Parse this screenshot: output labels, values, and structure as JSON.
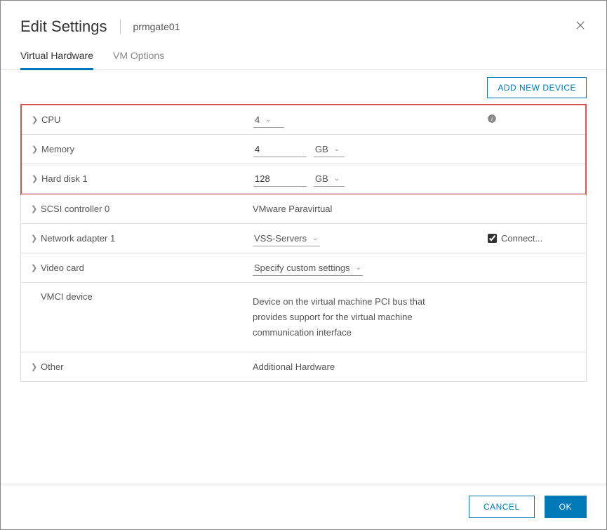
{
  "header": {
    "title": "Edit Settings",
    "subtitle": "prmgate01"
  },
  "tabs": {
    "virtual_hardware": "Virtual Hardware",
    "vm_options": "VM Options"
  },
  "toolbar": {
    "add_device": "ADD NEW DEVICE"
  },
  "rows": {
    "cpu": {
      "label": "CPU",
      "value": "4"
    },
    "memory": {
      "label": "Memory",
      "value": "4",
      "unit": "GB"
    },
    "hard_disk": {
      "label": "Hard disk 1",
      "value": "128",
      "unit": "GB"
    },
    "scsi": {
      "label": "SCSI controller 0",
      "value": "VMware Paravirtual"
    },
    "network": {
      "label": "Network adapter 1",
      "value": "VSS-Servers",
      "connected_label": "Connect...",
      "connected": true
    },
    "video": {
      "label": "Video card",
      "value": "Specify custom settings"
    },
    "vmci": {
      "label": "VMCI device",
      "value": "Device on the virtual machine PCI bus that provides support for the virtual machine communication interface"
    },
    "other": {
      "label": "Other",
      "value": "Additional Hardware"
    }
  },
  "footer": {
    "cancel": "CANCEL",
    "ok": "OK"
  }
}
